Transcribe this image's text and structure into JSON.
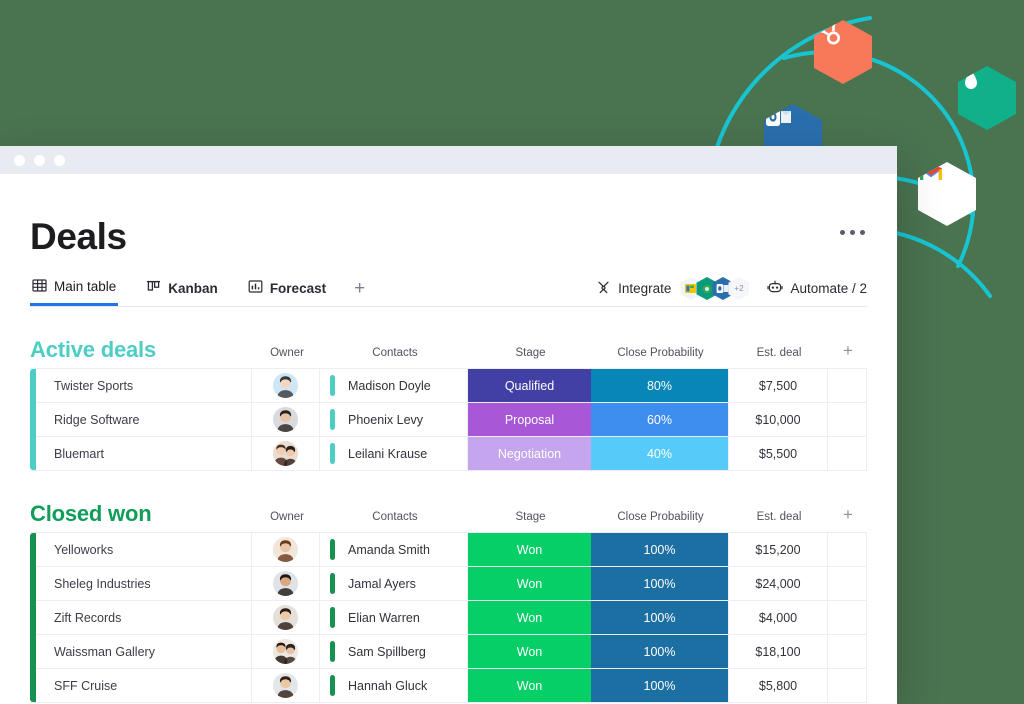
{
  "theme": {
    "page_bg": "#4a7350",
    "orbit_arc_color": "#17c5d2",
    "active_group_color": "#4ecdc4",
    "won_group_color": "#0f9d58",
    "tab_active_underline": "#1f76e8"
  },
  "orbit": {
    "badges": [
      {
        "name": "hubspot-icon",
        "label": "HubSpot",
        "color": "#f8795a"
      },
      {
        "name": "monday-icon",
        "label": "Monday",
        "color": "#0fb08a"
      },
      {
        "name": "outlook-icon",
        "label": "Outlook",
        "color": "#2a6fad"
      },
      {
        "name": "gmail-icon",
        "label": "Gmail",
        "color": "#ffffff"
      }
    ]
  },
  "window": {
    "titlebar_dots": 3
  },
  "header": {
    "title": "Deals",
    "kebab_label": "More options"
  },
  "tabs": [
    {
      "label": "Main table",
      "icon": "grid-icon",
      "active": true,
      "bold": false
    },
    {
      "label": "Kanban",
      "icon": "kanban-icon",
      "active": false,
      "bold": true
    },
    {
      "label": "Forecast",
      "icon": "chart-icon",
      "active": false,
      "bold": true
    }
  ],
  "tab_add_label": "+",
  "toolbar": {
    "integrate_label": "Integrate",
    "integrate_icon": "integrate-icon",
    "integration_overflow": "+2",
    "automate_label": "Automate / 2",
    "automate_icon": "robot-icon"
  },
  "columns": {
    "owner": "Owner",
    "contacts": "Contacts",
    "stage": "Stage",
    "probability": "Close Probability",
    "estimate": "Est. deal",
    "add": "+"
  },
  "groups": [
    {
      "title": "Active deals",
      "title_color": "#4ecdc4",
      "bar_color": "#4ecdc4",
      "contact_bar_color": "#4ecdc4",
      "rows": [
        {
          "name": "Twister Sports",
          "owner_avatar": "avatar-twister",
          "contact": "Madison Doyle",
          "stage": "Qualified",
          "stage_bg": "#4340a5",
          "probability": "80%",
          "prob_bg": "#0886b8",
          "estimate": "$7,500"
        },
        {
          "name": "Ridge Software",
          "owner_avatar": "avatar-ridge",
          "contact": "Phoenix Levy",
          "stage": "Proposal",
          "stage_bg": "#a857d6",
          "probability": "60%",
          "prob_bg": "#3e8eef",
          "estimate": "$10,000"
        },
        {
          "name": "Bluemart",
          "owner_avatar": "avatar-bluemart",
          "contact": "Leilani Krause",
          "stage": "Negotiation",
          "stage_bg": "#c4a5ee",
          "probability": "40%",
          "prob_bg": "#56cbfa",
          "estimate": "$5,500"
        }
      ]
    },
    {
      "title": "Closed won",
      "title_color": "#0f9d58",
      "bar_color": "#17914f",
      "contact_bar_color": "#17914f",
      "rows": [
        {
          "name": "Yelloworks",
          "owner_avatar": "avatar-yelloworks",
          "contact": "Amanda Smith",
          "stage": "Won",
          "stage_bg": "#05cf66",
          "probability": "100%",
          "prob_bg": "#1c6fa3",
          "estimate": "$15,200"
        },
        {
          "name": "Sheleg Industries",
          "owner_avatar": "avatar-sheleg",
          "contact": "Jamal Ayers",
          "stage": "Won",
          "stage_bg": "#05cf66",
          "probability": "100%",
          "prob_bg": "#1c6fa3",
          "estimate": "$24,000"
        },
        {
          "name": "Zift Records",
          "owner_avatar": "avatar-zift",
          "contact": "Elian Warren",
          "stage": "Won",
          "stage_bg": "#05cf66",
          "probability": "100%",
          "prob_bg": "#1c6fa3",
          "estimate": "$4,000"
        },
        {
          "name": "Waissman Gallery",
          "owner_avatar": "avatar-waissman",
          "contact": "Sam Spillberg",
          "stage": "Won",
          "stage_bg": "#05cf66",
          "probability": "100%",
          "prob_bg": "#1c6fa3",
          "estimate": "$18,100"
        },
        {
          "name": "SFF Cruise",
          "owner_avatar": "avatar-sff",
          "contact": "Hannah Gluck",
          "stage": "Won",
          "stage_bg": "#05cf66",
          "probability": "100%",
          "prob_bg": "#1c6fa3",
          "estimate": "$5,800"
        }
      ]
    }
  ]
}
